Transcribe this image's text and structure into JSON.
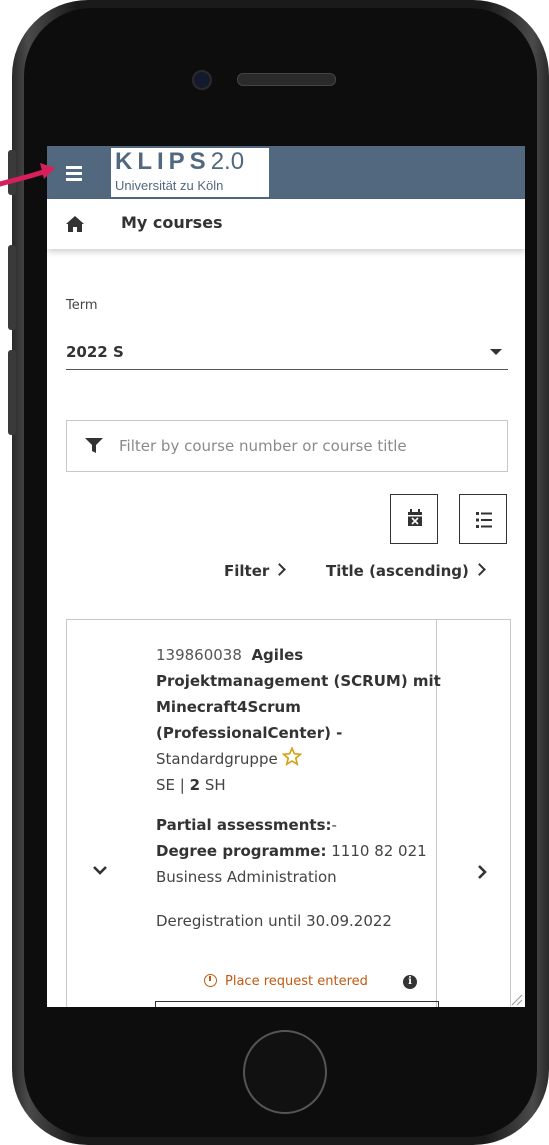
{
  "app": {
    "logo_title": "KLIPS",
    "logo_version": "2.0",
    "logo_subtitle": "Universität zu Köln"
  },
  "breadcrumb": {
    "title": "My courses"
  },
  "term": {
    "label": "Term",
    "value": "2022 S"
  },
  "filter": {
    "placeholder": "Filter by course number or course title"
  },
  "sort": {
    "filter_label": "Filter",
    "order_label": "Title (ascending)"
  },
  "course": {
    "number": "139860038",
    "title": "Agiles Projektmanagement (SCRUM) mit Minecraft4Scrum (ProfessionalCenter) -",
    "group": "Standardgruppe",
    "type": "SE |",
    "hours_value": "2",
    "hours_unit": "SH",
    "partial_label": "Partial assessments:",
    "partial_value": "-",
    "degree_label": "Degree programme:",
    "degree_value": "1110 82 021 Business Administration",
    "deregistration": "Deregistration until 30.09.2022",
    "status": "Place request entered",
    "info_glyph": "i"
  },
  "colors": {
    "appbar": "#52687f",
    "status": "#c05a12",
    "pointer": "#d6205b"
  }
}
